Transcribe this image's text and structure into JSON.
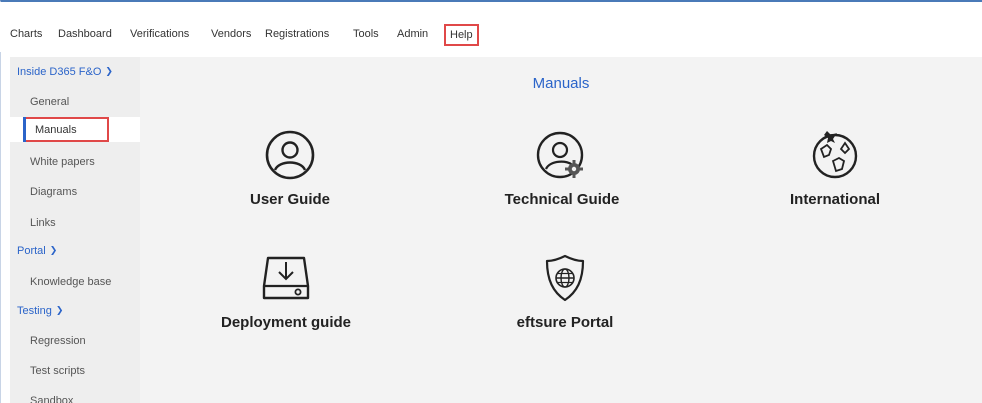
{
  "topnav": {
    "items": [
      "Charts",
      "Dashboard",
      "Verifications",
      "Vendors",
      "Registrations",
      "Tools",
      "Admin"
    ],
    "help": "Help"
  },
  "sidebar": {
    "section1": "Inside D365 F&O",
    "general": "General",
    "manuals": "Manuals",
    "white_papers": "White papers",
    "diagrams": "Diagrams",
    "links": "Links",
    "section2": "Portal",
    "knowledge_base": "Knowledge base",
    "section3": "Testing",
    "regression": "Regression",
    "test_scripts": "Test scripts",
    "sandbox": "Sandbox"
  },
  "main": {
    "title": "Manuals",
    "cards": {
      "user_guide": "User Guide",
      "technical_guide": "Technical Guide",
      "international": "International",
      "deployment_guide": "Deployment guide",
      "eftsure_portal": "eftsure Portal"
    }
  },
  "colors": {
    "accent": "#2b64c9",
    "highlight": "#e04848",
    "background": "#f3f3f3"
  },
  "icons": [
    "user-circle-icon",
    "user-gear-icon",
    "globe-plane-icon",
    "drive-download-icon",
    "shield-globe-icon",
    "chevron-down-icon"
  ]
}
